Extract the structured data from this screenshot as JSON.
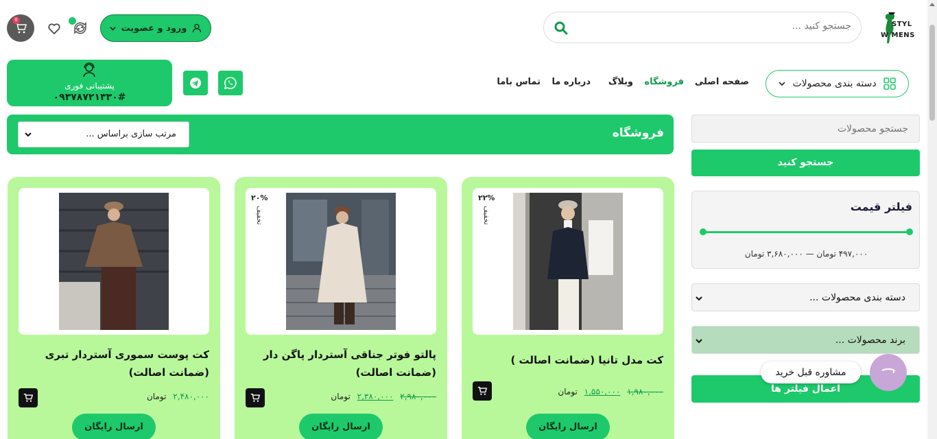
{
  "brand": {
    "logo_line1": "STYL",
    "logo_line2": "W  MENS"
  },
  "header": {
    "search_placeholder": "جستجو کنید ...",
    "login_label": "ورود و عضویت",
    "cart_count": "0"
  },
  "nav": {
    "categories_label": "دسته بندی محصولات",
    "items": [
      "صفحه اصلی",
      "فروشگاه",
      "وبلاگ",
      "درباره ما",
      "تماس باما"
    ]
  },
  "support": {
    "label": "پشتیبانی فوری",
    "phone": "۰۹۳۷۸۷۲۱۳۳۰#"
  },
  "shop": {
    "title": "فروشگاه",
    "sort_label": "مرتب سازی براساس ..."
  },
  "products": [
    {
      "title": "کت مدل تانیا (ضمانت اصالت )",
      "discount": "۲۲%",
      "discount_label": "تخفیف",
      "old_price": "۱,۹۸۰,۰۰۰",
      "new_price": "۱,۵۵۰,۰۰۰",
      "currency": "تومان",
      "shipping": "ارسال رایگان"
    },
    {
      "title": "پالتو فوتر جناقی آستردار پاگن دار (ضمانت اصالت)",
      "discount": "۲۰%",
      "discount_label": "تخفیف",
      "old_price": "۲,۹۸۰,۰۰۰",
      "new_price": "۲,۳۸۰,۰۰۰",
      "currency": "تومان",
      "shipping": "ارسال رایگان"
    },
    {
      "title": "کت پوست سموری آستردار تبری (ضمانت اصالت)",
      "price": "۲,۴۸۰,۰۰۰",
      "currency": "تومان",
      "shipping": "ارسال رایگان"
    }
  ],
  "sidebar": {
    "search_placeholder": "جستجو محصولات",
    "search_button": "جستجو کنید",
    "price_filter_title": "فیلتر قیمت",
    "price_range_text": "۴۹۷,۰۰۰ تومان — ۳,۶۸۰,۰۰۰ تومان",
    "category_select": "دسته بندی محصولات ...",
    "brand_select": "برند محصولات ...",
    "apply_button": "اعمال فیلتر ها"
  },
  "consult": {
    "label": "مشاوره قبل خرید"
  },
  "colors": {
    "accent": "#1ec96b",
    "card_bg": "#b8f89a",
    "price": "#0e9a4b"
  }
}
